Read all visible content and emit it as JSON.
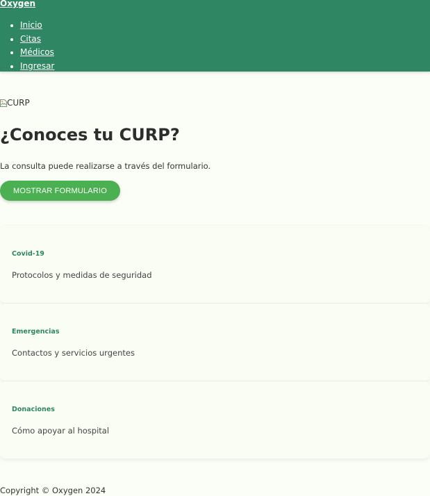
{
  "header": {
    "brand": "Oxygen",
    "nav": [
      {
        "label": "Inicio"
      },
      {
        "label": "Citas"
      },
      {
        "label": "Médicos"
      },
      {
        "label": "Ingresar"
      }
    ]
  },
  "hero": {
    "image_alt": "CURP",
    "title": "¿Conoces tu CURP?",
    "text": "La consulta puede realizarse a través del formulario.",
    "button_label": "MOSTRAR FORMULARIO"
  },
  "cards": [
    {
      "title": "Covid-19",
      "description": "Protocolos y medidas de seguridad"
    },
    {
      "title": "Emergencias",
      "description": "Contactos y servicios urgentes"
    },
    {
      "title": "Donaciones",
      "description": "Cómo apoyar al hospital"
    }
  ],
  "footer": {
    "copyright": "Copyright © Oxygen 2024"
  },
  "colors": {
    "header_bg": "#2e8663",
    "button_bg": "#4bb052",
    "page_bg": "#fbfef6",
    "card_title": "#2e8663"
  },
  "icons": {
    "broken_image": "broken-image-icon"
  }
}
